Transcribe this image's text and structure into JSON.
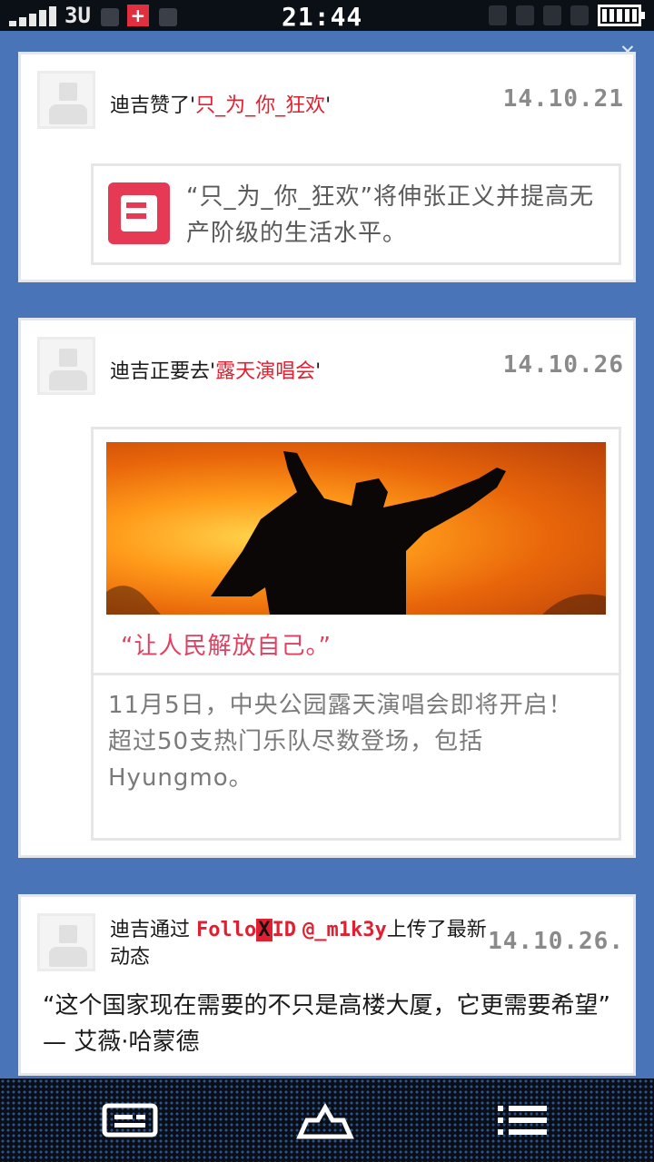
{
  "status_bar": {
    "carrier": "3U",
    "time": "21:44"
  },
  "feed": [
    {
      "actor_prefix": "迪吉赞了'",
      "actor_target": "只_为_你_狂欢",
      "actor_suffix": "'",
      "date": "14.10.21",
      "quote": "“只_为_你_狂欢”将伸张正义并提高无产阶级的生活水平。"
    },
    {
      "actor_prefix": "迪吉正要去'",
      "actor_target": "露天演唱会",
      "actor_suffix": "'",
      "date": "14.10.26",
      "slogan": "“让人民解放自己。”",
      "description_line1": "11月5日，中央公园露天演唱会即将开启！",
      "description_line2": "超过50支热门乐队尽数登场，包括Hyungmo。"
    },
    {
      "actor_prefix": "迪吉通过",
      "app_name_a": "Follo",
      "app_badge": "X",
      "app_name_b": "ID",
      "handle": "@_m1k3y",
      "actor_suffix": "上传了最新动态",
      "date": "14.10.26.",
      "quote": "“这个国家现在需要的不只是高楼大厦，它更需要希望” — 艾薇·哈蒙德"
    }
  ],
  "nav": {
    "icons": [
      "messages-icon",
      "home-icon",
      "menu-icon"
    ]
  },
  "colors": {
    "background": "#4a74b8",
    "highlight": "#e02030",
    "slogan": "#e24060"
  }
}
